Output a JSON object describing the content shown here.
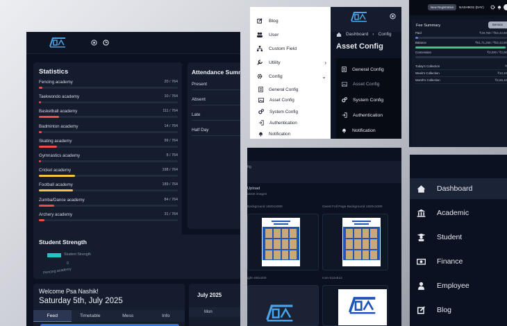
{
  "dashboard": {
    "statistics": {
      "title": "Statistics",
      "items": [
        {
          "label": "Fencing academy",
          "count": "20 / 764",
          "ratio": 0.026,
          "color": "#ef4b4b"
        },
        {
          "label": "Taekwondo academy",
          "count": "10 / 764",
          "ratio": 0.013,
          "color": "#ef4b4b"
        },
        {
          "label": "Basketball academy",
          "count": "111 / 764",
          "ratio": 0.145,
          "color": "#ef4b4b"
        },
        {
          "label": "Badminton academy",
          "count": "14 / 764",
          "ratio": 0.018,
          "color": "#ef4b4b"
        },
        {
          "label": "Skating academy",
          "count": "99 / 764",
          "ratio": 0.13,
          "color": "#ef4b4b"
        },
        {
          "label": "Gymnastics academy",
          "count": "8 / 764",
          "ratio": 0.01,
          "color": "#ef4b4b"
        },
        {
          "label": "Cricket academy",
          "count": "198 / 764",
          "ratio": 0.259,
          "color": "#f5c542"
        },
        {
          "label": "Football academy",
          "count": "189 / 764",
          "ratio": 0.247,
          "color": "#f5c542"
        },
        {
          "label": "Zumba/Dance academy",
          "count": "84 / 764",
          "ratio": 0.11,
          "color": "#ef4b4b"
        },
        {
          "label": "Archery academy",
          "count": "31 / 764",
          "ratio": 0.041,
          "color": "#ef4b4b"
        }
      ]
    },
    "attendance": {
      "title": "Attendance Summ",
      "rows": [
        "Present",
        "Absent",
        "Late",
        "Half Day"
      ]
    },
    "strength": {
      "title": "Student Strength",
      "legend": "Student Strength",
      "zero": "0",
      "axis_label": "Fencing academy"
    },
    "welcome": {
      "greeting": "Welcome Psa Nashik!",
      "date": "Saturday 5th, July 2025",
      "tabs": [
        "Feed",
        "Timetable",
        "Mess",
        "Info"
      ]
    },
    "calendar": {
      "month": "July 2025",
      "day_header": "Mon"
    }
  },
  "menu": {
    "items": [
      {
        "label": "Blog",
        "icon": "edit-icon"
      },
      {
        "label": "User",
        "icon": "users-icon"
      },
      {
        "label": "Custom Field",
        "icon": "sitemap-icon"
      },
      {
        "label": "Utility",
        "icon": "tools-icon"
      },
      {
        "label": "Config",
        "icon": "gear-icon"
      }
    ],
    "sub_items": [
      {
        "label": "General Config",
        "icon": "doc-icon"
      },
      {
        "label": "Asset Config",
        "icon": "image-icon"
      },
      {
        "label": "System Config",
        "icon": "cogs-icon"
      },
      {
        "label": "Authentication",
        "icon": "login-icon"
      },
      {
        "label": "Notification",
        "icon": "bell-icon"
      }
    ],
    "breadcrumb": {
      "home": "Dashboard",
      "current": "Config"
    },
    "page_title": "Asset Config",
    "dropdown": [
      "General Config",
      "Asset Config",
      "System Config",
      "Authentication",
      "Notification"
    ]
  },
  "asset": {
    "breadcrumb_fragment": "fig",
    "upload_title": "Upload",
    "upload_sub": "asset images",
    "bg_label": "Background  1920x1080",
    "guest_label": "Guest Full Page Background  1920x1080",
    "logo_label": "ight  400x200",
    "icon_label": "Icon  512x512"
  },
  "fee": {
    "new_registration": "New Registration",
    "user": "NASHIK01 (DAY)",
    "title": "Fee Summary",
    "service": "Service",
    "rows": [
      {
        "label": "Paid",
        "value": "₹19,750 / ₹62,42,60",
        "ratio": 0.03,
        "color": "#4f7fe0"
      },
      {
        "label": "Balance",
        "value": "₹61,71,250 / ₹62,42,60",
        "ratio": 0.985,
        "color": "#3fc48a"
      },
      {
        "label": "Concession",
        "value": "₹3,000 / ₹2,00"
      }
    ],
    "extra": [
      {
        "label": "Today's Collection",
        "value": "₹"
      },
      {
        "label": "Week's Collection",
        "value": "₹10,10"
      },
      {
        "label": "Month's Collection",
        "value": "₹2,65,10"
      }
    ]
  },
  "nav": [
    {
      "label": "Dashboard",
      "icon": "home-icon"
    },
    {
      "label": "Academic",
      "icon": "bank-icon"
    },
    {
      "label": "Student",
      "icon": "graduate-icon"
    },
    {
      "label": "Finance",
      "icon": "money-icon"
    },
    {
      "label": "Employee",
      "icon": "person-icon"
    },
    {
      "label": "Blog",
      "icon": "edit-icon"
    }
  ]
}
